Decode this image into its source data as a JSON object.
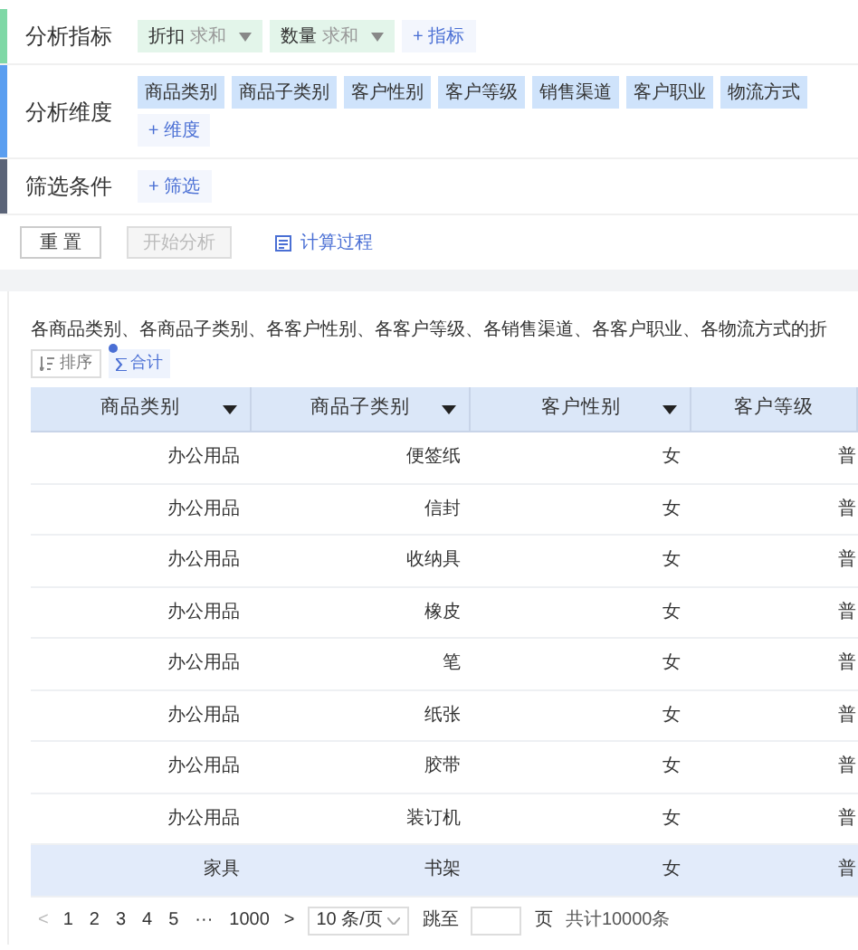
{
  "config": [
    {
      "kind": "metrics",
      "label": "分析指标",
      "color": "#7fd8a6",
      "tags": [
        {
          "name": "折扣",
          "agg": "求和"
        },
        {
          "name": "数量",
          "agg": "求和"
        }
      ],
      "add": "+ 指标"
    },
    {
      "kind": "dimensions",
      "label": "分析维度",
      "color": "#5a9ef0",
      "tags": [
        {
          "name": "商品类别"
        },
        {
          "name": "商品子类别"
        },
        {
          "name": "客户性别"
        },
        {
          "name": "客户等级"
        },
        {
          "name": "销售渠道"
        },
        {
          "name": "客户职业"
        },
        {
          "name": "物流方式"
        }
      ],
      "add": "+ 维度"
    },
    {
      "kind": "filters",
      "label": "筛选条件",
      "color": "#5b6478",
      "add": "+ 筛选"
    }
  ],
  "actions": {
    "reset": "重 置",
    "start": {
      "label": "开始分析",
      "disabled": true
    },
    "process": "计算过程"
  },
  "result": {
    "title": "各商品类别、各商品子类别、各客户性别、各客户等级、各销售渠道、各客户职业、各物流方式的折",
    "sort": "排序",
    "total": "合计",
    "columns": [
      "商品类别",
      "商品子类别",
      "客户性别",
      "客户等级"
    ],
    "rows": [
      {
        "cells": [
          "办公用品",
          "便签纸",
          "女",
          "普"
        ],
        "selected": false
      },
      {
        "cells": [
          "办公用品",
          "信封",
          "女",
          "普"
        ],
        "selected": false
      },
      {
        "cells": [
          "办公用品",
          "收纳具",
          "女",
          "普"
        ],
        "selected": false
      },
      {
        "cells": [
          "办公用品",
          "橡皮",
          "女",
          "普"
        ],
        "selected": false
      },
      {
        "cells": [
          "办公用品",
          "笔",
          "女",
          "普"
        ],
        "selected": false
      },
      {
        "cells": [
          "办公用品",
          "纸张",
          "女",
          "普"
        ],
        "selected": false
      },
      {
        "cells": [
          "办公用品",
          "胶带",
          "女",
          "普"
        ],
        "selected": false
      },
      {
        "cells": [
          "办公用品",
          "装订机",
          "女",
          "普"
        ],
        "selected": false
      },
      {
        "cells": [
          "家具",
          "书架",
          "女",
          "普"
        ],
        "selected": true
      }
    ]
  },
  "pagination": {
    "prev": "<",
    "pages": [
      "1",
      "2",
      "3",
      "4",
      "5",
      "···",
      "1000"
    ],
    "next": ">",
    "page_size": "10 条/页",
    "jump_label": "跳至",
    "jump_suffix": "页",
    "total": "共计10000条"
  }
}
